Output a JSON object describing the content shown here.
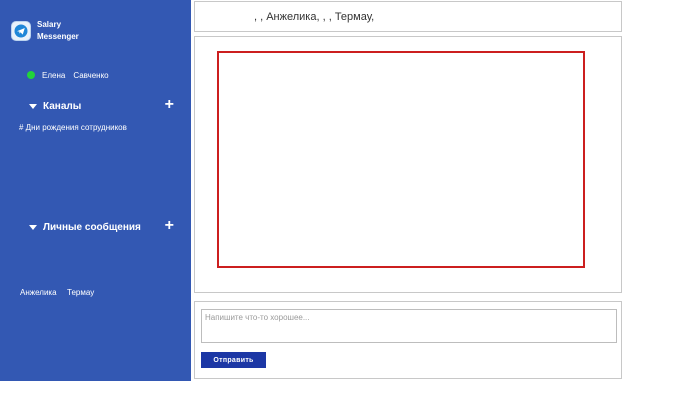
{
  "app": {
    "name_line1": "Salary",
    "name_line2": "Messenger",
    "logo_icon": "messenger-logo-icon"
  },
  "user": {
    "first_name": "Елена",
    "last_name": "Савченко",
    "status": "online",
    "status_color": "#22d33a"
  },
  "sidebar": {
    "background": "#3358b3",
    "channels": {
      "title": "Каналы",
      "items": [
        "# Дни рождения сотрудников"
      ]
    },
    "direct_messages": {
      "title": "Личные сообщения",
      "items": [
        {
          "first_name": "Анжелика",
          "last_name": "Термау"
        }
      ]
    }
  },
  "chat": {
    "header_text": ", , Анжелика, , , Термау,"
  },
  "composer": {
    "placeholder": "Напишите что-то хорошее...",
    "value": "",
    "send_label": "Отправить",
    "send_color": "#1c37a5"
  }
}
